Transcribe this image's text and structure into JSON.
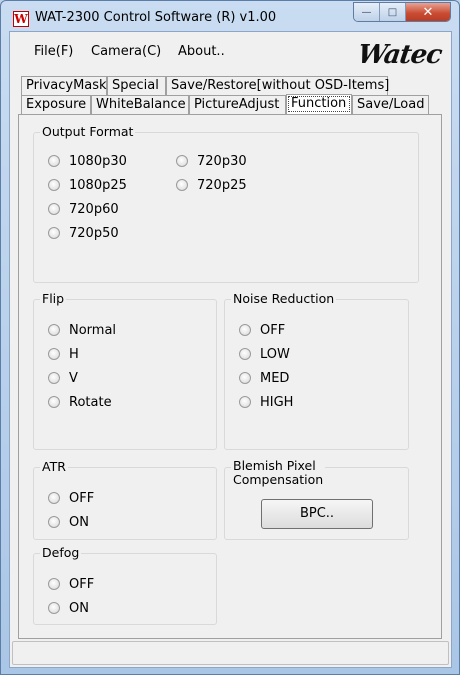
{
  "window": {
    "title": "WAT-2300 Control Software (R) v1.00",
    "icon_glyph": "W",
    "minimize_glyph": "—",
    "maximize_glyph": "□",
    "close_glyph": "✕"
  },
  "menu": {
    "file": "File(F)",
    "camera": "Camera(C)",
    "about": "About..",
    "logo": "Watec"
  },
  "tabs": {
    "row1": [
      "PrivacyMask",
      "Special",
      "Save/Restore[without OSD-Items]"
    ],
    "row2": [
      "Exposure",
      "WhiteBalance",
      "PictureAdjust",
      "Function",
      "Save/Load"
    ],
    "active": "Function"
  },
  "output_format": {
    "title": "Output Format",
    "options": [
      "1080p30",
      "1080p25",
      "720p60",
      "720p50",
      "720p30",
      "720p25"
    ]
  },
  "flip": {
    "title": "Flip",
    "options": [
      "Normal",
      "H",
      "V",
      "Rotate"
    ]
  },
  "noise_reduction": {
    "title": "Noise Reduction",
    "options": [
      "OFF",
      "LOW",
      "MED",
      "HIGH"
    ]
  },
  "atr": {
    "title": "ATR",
    "options": [
      "OFF",
      "ON"
    ]
  },
  "blemish": {
    "title_line1": "Blemish Pixel",
    "title_line2": "Compensation",
    "button": "BPC.."
  },
  "defog": {
    "title": "Defog",
    "options": [
      "OFF",
      "ON"
    ]
  },
  "statusbar": {
    "text": ""
  }
}
